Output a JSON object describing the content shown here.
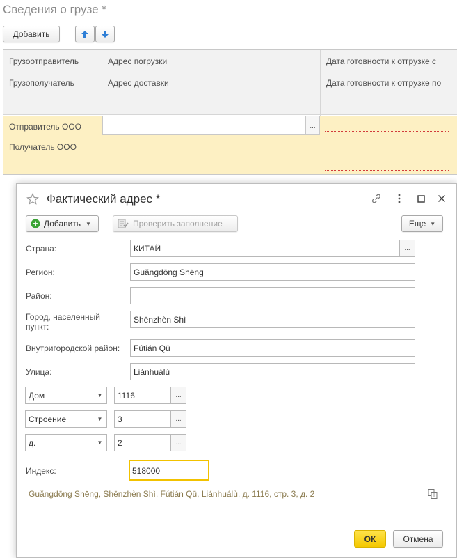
{
  "section": {
    "title": "Сведения о грузе *",
    "add_label": "Добавить"
  },
  "grid": {
    "headers": {
      "col1_row1": "Грузоотправитель",
      "col1_row2": "Грузополучатель",
      "col2_row1": "Адрес погрузки",
      "col2_row2": "Адрес доставки",
      "col3_row1": "Дата готовности к отгрузке с",
      "col3_row2": "Дата готовности к отгрузке по"
    },
    "row": {
      "sender": "Отправитель ООО",
      "receiver": "Получатель ООО",
      "more_label": "..."
    }
  },
  "dialog": {
    "title": "Фактический адрес *",
    "toolbar": {
      "add_label": "Добавить",
      "check_label": "Проверить заполнение",
      "more_label": "Еще"
    },
    "fields": {
      "country_label": "Страна:",
      "country_value": "КИТАЙ",
      "region_label": "Регион:",
      "region_value": "Guǎngdōng Shěng",
      "district_label": "Район:",
      "district_value": "",
      "city_label": "Город, населенный пункт:",
      "city_value": "Shēnzhèn Shì",
      "intracity_label": "Внутригородской район:",
      "intracity_value": "Fútián Qū",
      "street_label": "Улица:",
      "street_value": "Liánhuálù",
      "house_type": "Дом",
      "house_value": "1116",
      "building_type": "Строение",
      "building_value": "3",
      "unit_type": "д.",
      "unit_value": "2",
      "index_label": "Индекс:",
      "index_value": "518000",
      "more_label": "..."
    },
    "summary": "Guǎngdōng Shěng, Shēnzhèn Shì, Fútián Qū, Liánhuálù, д. 1116, стр. 3, д. 2",
    "ok_label": "ОК",
    "cancel_label": "Отмена"
  },
  "colors": {
    "accent": "#f4c800",
    "row_highlight": "#fdf0c3",
    "add_icon": "#3aa335",
    "arrow_icon": "#2f7fd6"
  },
  "icons": [
    "arrow-up-icon",
    "arrow-down-icon",
    "star-icon",
    "link-icon",
    "kebab-menu-icon",
    "maximize-icon",
    "close-icon",
    "plus-circle-icon",
    "check-form-icon",
    "copy-icon",
    "chevron-down-icon"
  ]
}
